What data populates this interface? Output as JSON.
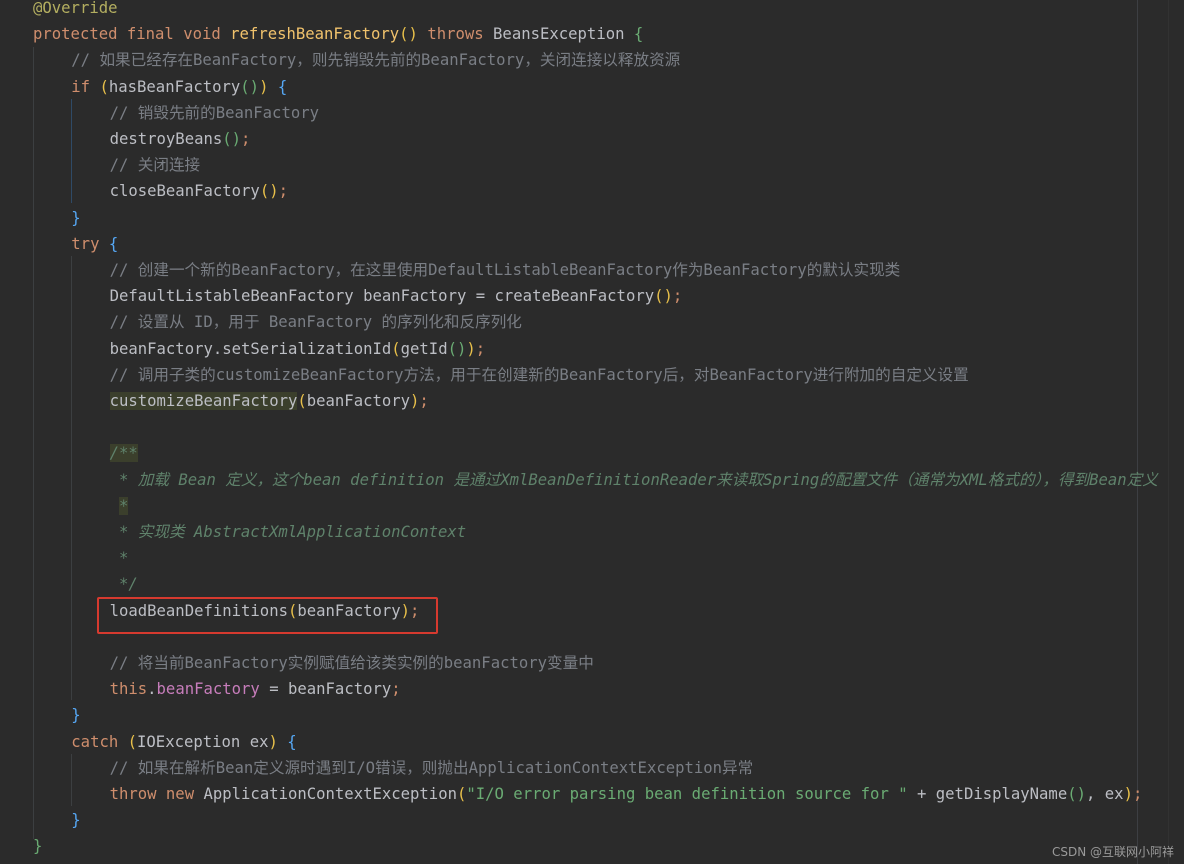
{
  "editor": {
    "language": "java",
    "colors": {
      "background": "#2b2b2b",
      "keyword": "#cf8e6d",
      "comment": "#7a7e85",
      "doc_comment": "#5f826b",
      "string": "#6aab73",
      "field": "#c77dbb",
      "highlight_box": "#d63a2f"
    },
    "lines": [
      {
        "indent": 0,
        "tokens": [
          [
            "@Override",
            "ann"
          ]
        ]
      },
      {
        "indent": 0,
        "tokens": [
          [
            "protected final void ",
            "kw"
          ],
          [
            "refreshBeanFactory",
            "fn"
          ],
          [
            "()",
            "py"
          ],
          [
            " throws ",
            "kw"
          ],
          [
            "BeansException ",
            ""
          ],
          [
            "{",
            "pg"
          ]
        ]
      },
      {
        "indent": 1,
        "tokens": [
          [
            "// 如果已经存在BeanFactory，则先销毁先前的BeanFactory，关闭连接以释放资源",
            "cm"
          ]
        ]
      },
      {
        "indent": 1,
        "tokens": [
          [
            "if ",
            "kw"
          ],
          [
            "(",
            "py"
          ],
          [
            "hasBeanFactory",
            ""
          ],
          [
            "()",
            "pg"
          ],
          [
            ")",
            "py"
          ],
          [
            " ",
            ""
          ],
          [
            "{",
            "pb"
          ]
        ]
      },
      {
        "indent": 2,
        "tokens": [
          [
            "// 销毁先前的BeanFactory",
            "cm"
          ]
        ]
      },
      {
        "indent": 2,
        "tokens": [
          [
            "destroyBeans",
            ""
          ],
          [
            "()",
            "pg"
          ],
          [
            ";",
            "kw"
          ]
        ]
      },
      {
        "indent": 2,
        "tokens": [
          [
            "// 关闭连接",
            "cm"
          ]
        ]
      },
      {
        "indent": 2,
        "tokens": [
          [
            "closeBeanFactory",
            ""
          ],
          [
            "()",
            "py"
          ],
          [
            ";",
            "kw"
          ]
        ]
      },
      {
        "indent": 1,
        "tokens": [
          [
            "}",
            "pb"
          ]
        ]
      },
      {
        "indent": 1,
        "tokens": [
          [
            "try ",
            "kw"
          ],
          [
            "{",
            "pb"
          ]
        ]
      },
      {
        "indent": 2,
        "tokens": [
          [
            "// 创建一个新的BeanFactory，在这里使用DefaultListableBeanFactory作为BeanFactory的默认实现类",
            "cm"
          ]
        ]
      },
      {
        "indent": 2,
        "tokens": [
          [
            "DefaultListableBeanFactory beanFactory = createBeanFactory",
            ""
          ],
          [
            "()",
            "py"
          ],
          [
            ";",
            "kw"
          ]
        ]
      },
      {
        "indent": 2,
        "tokens": [
          [
            "// 设置从 ID，用于 BeanFactory 的序列化和反序列化",
            "cm"
          ]
        ]
      },
      {
        "indent": 2,
        "tokens": [
          [
            "beanFactory.setSerializationId",
            ""
          ],
          [
            "(",
            "py"
          ],
          [
            "getId",
            ""
          ],
          [
            "()",
            "pg"
          ],
          [
            ")",
            "py"
          ],
          [
            ";",
            "kw"
          ]
        ]
      },
      {
        "indent": 2,
        "tokens": [
          [
            "// 调用子类的customizeBeanFactory方法，用于在创建新的BeanFactory后，对BeanFactory进行附加的自定义设置",
            "cm"
          ]
        ]
      },
      {
        "indent": 2,
        "tokens": [
          [
            "customizeBeanFactory",
            "hl"
          ],
          [
            "(",
            "py"
          ],
          [
            "beanFactory",
            ""
          ],
          [
            ")",
            "py"
          ],
          [
            ";",
            "kw"
          ]
        ]
      },
      {
        "indent": 2,
        "tokens": []
      },
      {
        "indent": 2,
        "tokens": [
          [
            "/**",
            "doc hl"
          ]
        ]
      },
      {
        "indent": 2,
        "tokens": [
          [
            " * 加载 Bean 定义，这个bean definition 是通过XmlBeanDefinitionReader来读取Spring的配置文件（通常为XML格式的），得到Bean定义",
            "doc"
          ]
        ]
      },
      {
        "indent": 2,
        "tokens": [
          [
            " ",
            ""
          ],
          [
            "*",
            "doc hl"
          ]
        ]
      },
      {
        "indent": 2,
        "tokens": [
          [
            " * 实现类 AbstractXmlApplicationContext",
            "doc"
          ]
        ]
      },
      {
        "indent": 2,
        "tokens": [
          [
            " *",
            "doc"
          ]
        ]
      },
      {
        "indent": 2,
        "tokens": [
          [
            " */",
            "doc"
          ]
        ]
      },
      {
        "indent": 2,
        "tokens": [
          [
            "loadBeanDefinitions",
            ""
          ],
          [
            "(",
            "py"
          ],
          [
            "beanFactory",
            ""
          ],
          [
            ")",
            "py"
          ],
          [
            ";",
            "kw"
          ]
        ]
      },
      {
        "indent": 2,
        "tokens": []
      },
      {
        "indent": 2,
        "tokens": [
          [
            "// 将当前BeanFactory实例赋值给该类实例的beanFactory变量中",
            "cm"
          ]
        ]
      },
      {
        "indent": 2,
        "tokens": [
          [
            "this",
            "kw"
          ],
          [
            ".",
            ""
          ],
          [
            "beanFactory",
            "fld"
          ],
          [
            " = beanFactory",
            ""
          ],
          [
            ";",
            "kw"
          ]
        ]
      },
      {
        "indent": 1,
        "tokens": [
          [
            "}",
            "pb"
          ]
        ]
      },
      {
        "indent": 1,
        "tokens": [
          [
            "catch ",
            "kw"
          ],
          [
            "(",
            "py"
          ],
          [
            "IOException ex",
            ""
          ],
          [
            ")",
            "py"
          ],
          [
            " ",
            ""
          ],
          [
            "{",
            "pb"
          ]
        ]
      },
      {
        "indent": 2,
        "tokens": [
          [
            "// 如果在解析Bean定义源时遇到I/O错误，则抛出ApplicationContextException异常",
            "cm"
          ]
        ]
      },
      {
        "indent": 2,
        "tokens": [
          [
            "throw new ",
            "kw"
          ],
          [
            "ApplicationContextException",
            ""
          ],
          [
            "(",
            "py"
          ],
          [
            "\"I/O error parsing bean definition source for \"",
            "str"
          ],
          [
            " + getDisplayName",
            ""
          ],
          [
            "()",
            "pg"
          ],
          [
            ", ex",
            ""
          ],
          [
            ")",
            "py"
          ],
          [
            ";",
            "kw"
          ]
        ]
      },
      {
        "indent": 1,
        "tokens": [
          [
            "}",
            "pb"
          ]
        ]
      },
      {
        "indent": 0,
        "tokens": [
          [
            "}",
            "pg"
          ]
        ]
      }
    ]
  },
  "watermark": "CSDN @互联网小阿祥"
}
